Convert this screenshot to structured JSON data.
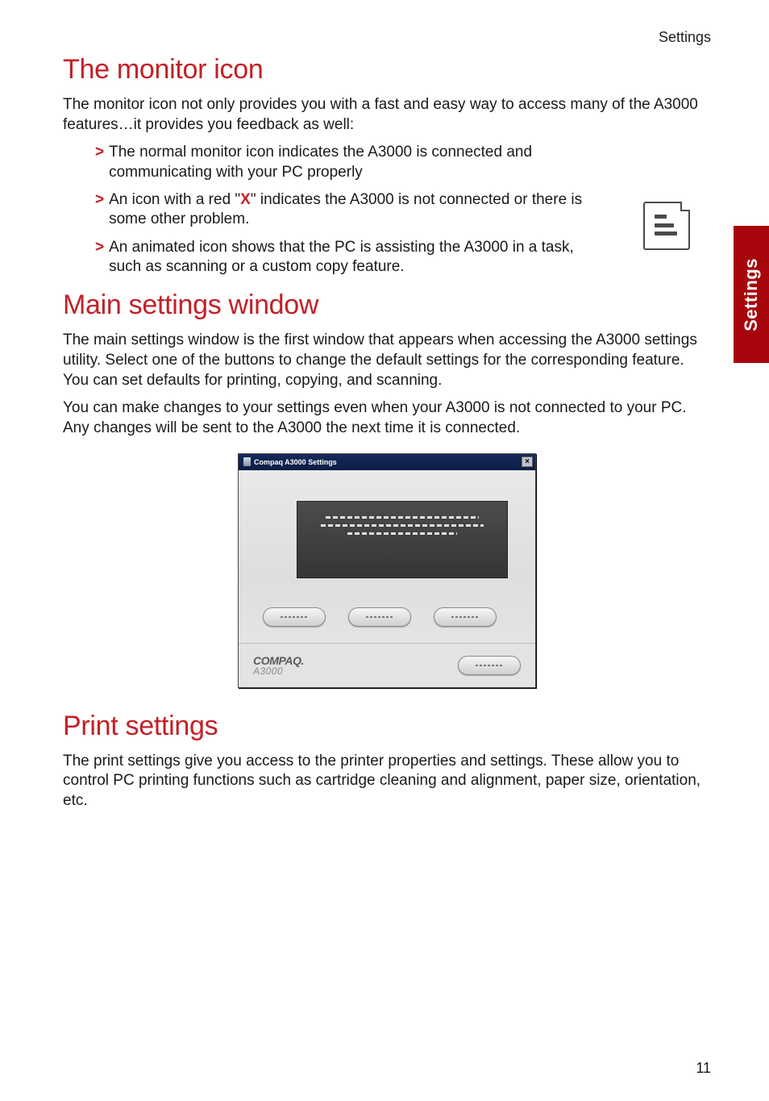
{
  "header": {
    "right": "Settings"
  },
  "section1": {
    "title": "The monitor icon",
    "intro": "The monitor icon not only provides you with a fast and easy way to access many of the A3000 features…it provides you feedback as well:",
    "bullets": [
      "The normal monitor icon indicates the A3000 is connected and communicating with your PC properly",
      {
        "pre": "An icon with a red \"",
        "x": "X",
        "post": "\" indicates the A3000 is not connected or there is some other problem."
      },
      "An animated icon shows that the PC is assisting the A3000 in a task, such as scanning or a custom copy feature."
    ]
  },
  "section2": {
    "title": "Main settings window",
    "p1": "The main settings window is the first window that appears when accessing the A3000 settings utility. Select one of the buttons to change the default settings for the corresponding feature. You can set defaults for printing, copying, and scanning.",
    "p2": "You can make changes to your settings even when your A3000 is not connected to your PC. Any changes will be sent to the A3000 the next time it is connected."
  },
  "screenshot": {
    "title": "Compaq A3000 Settings",
    "close": "×",
    "logo_top": "COMPAQ.",
    "logo_bottom": "A3000"
  },
  "section3": {
    "title": "Print settings",
    "p": "The print settings give you access to the printer properties and settings. These allow you to control PC printing functions such as cartridge cleaning and alignment, paper size, orientation, etc."
  },
  "side_tab": "Settings",
  "page_number": "11"
}
